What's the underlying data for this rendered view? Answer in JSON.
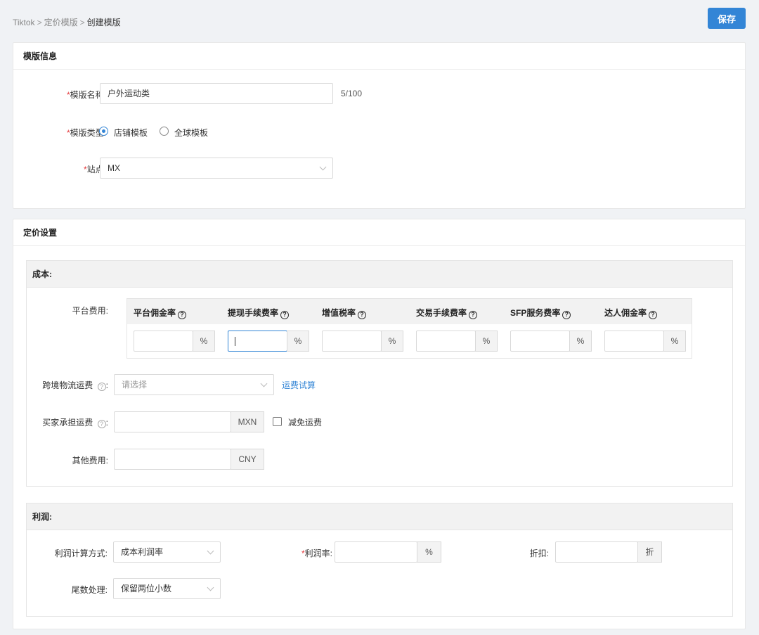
{
  "breadcrumb": {
    "items": [
      "Tiktok",
      "定价模版",
      "创建模版"
    ],
    "separator": ">"
  },
  "toolbar": {
    "save_label": "保存"
  },
  "template_info": {
    "title": "模版信息",
    "name": {
      "required": "*",
      "label": "模版名称",
      "colon": ":",
      "value": "户外运动类",
      "counter": "5/100"
    },
    "type": {
      "required": "*",
      "label": "模版类型",
      "colon": ":",
      "options": [
        "店铺模板",
        "全球模板"
      ],
      "selected": "店铺模板"
    },
    "site": {
      "required": "*",
      "label": "站点",
      "colon": ":",
      "value": "MX"
    }
  },
  "pricing": {
    "title": "定价设置",
    "cost": {
      "title": "成本:",
      "platform_fee": {
        "label": "平台费用",
        "colon": ":",
        "columns": [
          {
            "name": "平台佣金率",
            "unit": "%"
          },
          {
            "name": "提现手续费率",
            "unit": "%"
          },
          {
            "name": "增值税率",
            "unit": "%"
          },
          {
            "name": "交易手续费率",
            "unit": "%"
          },
          {
            "name": "SFP服务费率",
            "unit": "%"
          },
          {
            "name": "达人佣金率",
            "unit": "%"
          }
        ]
      },
      "logistics": {
        "label": "跨境物流运费",
        "colon": ":",
        "placeholder": "请选择",
        "link": "运费试算"
      },
      "buyer_shipping": {
        "label": "买家承担运费",
        "colon": ":",
        "unit": "MXN",
        "checkbox_label": "减免运费"
      },
      "other_fee": {
        "label": "其他费用",
        "colon": ":",
        "unit": "CNY"
      }
    },
    "profit": {
      "title": "利润:",
      "method": {
        "label": "利润计算方式",
        "colon": ":",
        "value": "成本利润率"
      },
      "rate": {
        "required": "*",
        "label": "利润率",
        "colon": ":",
        "unit": "%"
      },
      "discount": {
        "label": "折扣",
        "colon": ":",
        "unit": "折"
      },
      "rounding": {
        "label": "尾数处理",
        "colon": ":",
        "value": "保留两位小数"
      }
    }
  },
  "colors": {
    "accent": "#3385d6",
    "required": "#e4393c",
    "header_bg": "#f2f2f2"
  },
  "icons": {
    "help": "question-circle-icon",
    "dropdown": "chevron-down-icon"
  }
}
